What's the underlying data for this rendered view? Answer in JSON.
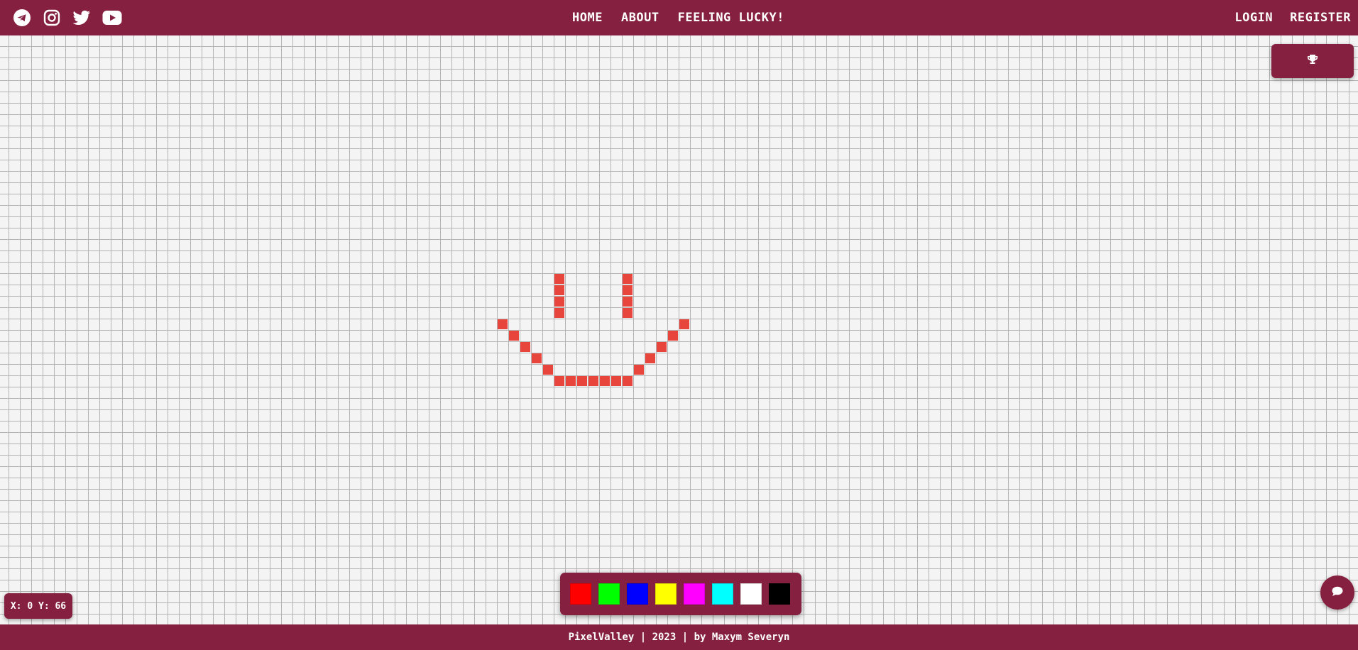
{
  "header": {
    "social": [
      {
        "name": "telegram-icon"
      },
      {
        "name": "instagram-icon"
      },
      {
        "name": "twitter-icon"
      },
      {
        "name": "youtube-icon"
      }
    ],
    "nav": {
      "home": "HOME",
      "about": "ABOUT",
      "lucky": "FEELING LUCKY!"
    },
    "auth": {
      "login": "LOGIN",
      "register": "REGISTER"
    }
  },
  "leaderboard": {
    "icon": "trophy-icon"
  },
  "palette": {
    "colors": [
      "#ff0000",
      "#00ff00",
      "#0000ff",
      "#ffff00",
      "#ff00ff",
      "#00ffff",
      "#ffffff",
      "#000000"
    ]
  },
  "canvas": {
    "pixel_color": "#e8453c",
    "painted_cells": [
      [
        49,
        21
      ],
      [
        49,
        22
      ],
      [
        49,
        23
      ],
      [
        49,
        24
      ],
      [
        55,
        21
      ],
      [
        55,
        22
      ],
      [
        55,
        23
      ],
      [
        55,
        24
      ],
      [
        44,
        25
      ],
      [
        45,
        26
      ],
      [
        46,
        27
      ],
      [
        47,
        28
      ],
      [
        48,
        29
      ],
      [
        49,
        30
      ],
      [
        50,
        30
      ],
      [
        51,
        30
      ],
      [
        52,
        30
      ],
      [
        53,
        30
      ],
      [
        54,
        30
      ],
      [
        55,
        30
      ],
      [
        56,
        29
      ],
      [
        57,
        28
      ],
      [
        58,
        27
      ],
      [
        59,
        26
      ],
      [
        60,
        25
      ]
    ]
  },
  "coords": {
    "text": "X: 0 Y: 66"
  },
  "chat": {
    "icon": "chat-bubble-icon"
  },
  "footer": {
    "text": "PixelValley | 2023 | by Maxym Severyn"
  },
  "colors": {
    "brand": "#862040",
    "grid_line": "#b3b3b3"
  }
}
